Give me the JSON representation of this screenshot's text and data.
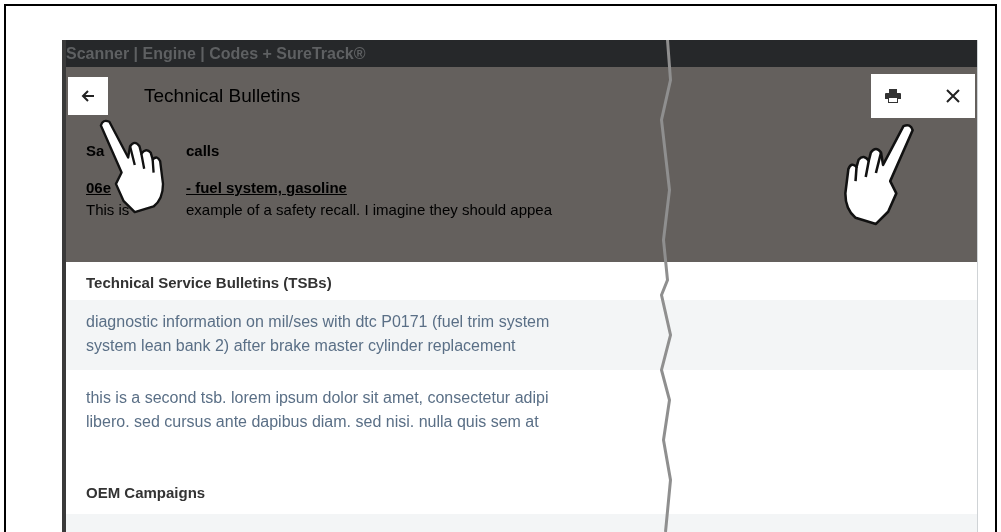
{
  "app_bar": {
    "title": "Scanner | Engine | Codes + SureTrack®"
  },
  "header": {
    "title": "Technical Bulletins"
  },
  "safety_recalls": {
    "heading_parts": [
      "Sa",
      "calls"
    ],
    "link_parts": [
      "06e",
      "- fuel system, gasoline"
    ],
    "description_parts": [
      "This is",
      "example of a safety recall. I imagine they should appea"
    ]
  },
  "tsbs": {
    "heading": "Technical Service Bulletins (TSBs)",
    "items": [
      {
        "lines": [
          "diagnostic information on mil/ses with dtc P0171 (fuel trim system",
          "system lean bank 2) after brake master cylinder replacement"
        ]
      },
      {
        "lines": [
          "this is a second tsb. lorem ipsum dolor sit amet, consectetur adipi",
          "libero. sed cursus ante dapibus diam. sed nisi. nulla quis sem at"
        ]
      }
    ]
  },
  "oem_campaigns": {
    "heading": "OEM Campaigns"
  }
}
